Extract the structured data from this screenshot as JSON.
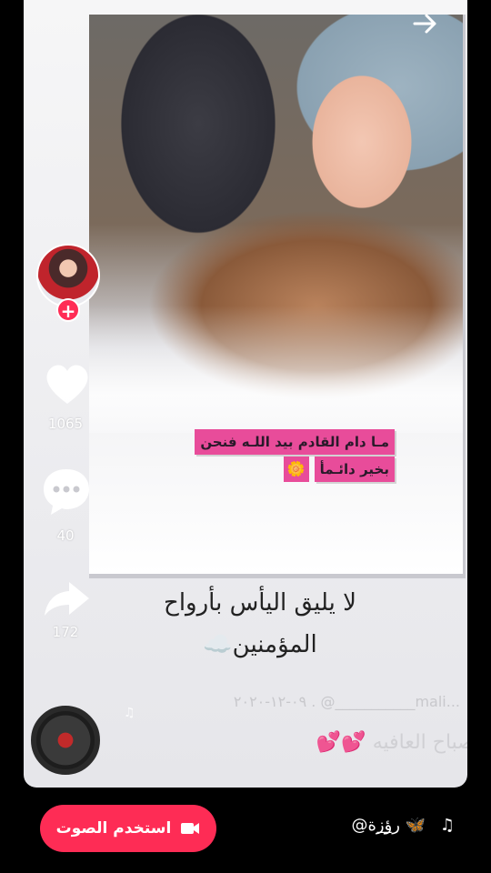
{
  "overlay_text": {
    "line1": "مـا دام القادم بيد اللـه فنحن",
    "line2": "بخير دائـمأ",
    "flower": "🌼"
  },
  "caption": {
    "line1": "لا يليق اليأس بأرواح",
    "line2": "المؤمنين",
    "emoji": "☁️"
  },
  "watermark": "٠٩-١٢-٢٠٢٠ . @___________mali...",
  "greeting": {
    "text": "صباح العافيه",
    "hearts": "💕💕"
  },
  "actions": {
    "likes": "1065",
    "comments": "40",
    "shares": "172"
  },
  "bottom": {
    "use_sound_label": "استخدم الصوت",
    "sound_title": "@رؤ͟زة 🦋",
    "note_symbol": "♫"
  },
  "colors": {
    "accent": "#fe2c55",
    "banner": "#e84c9a"
  },
  "icons": {
    "share_top": "arrow-right-icon",
    "like": "heart-icon",
    "comment": "comment-bubble-icon",
    "share": "share-arrow-icon",
    "camera": "video-camera-icon",
    "music": "music-note-icon"
  }
}
